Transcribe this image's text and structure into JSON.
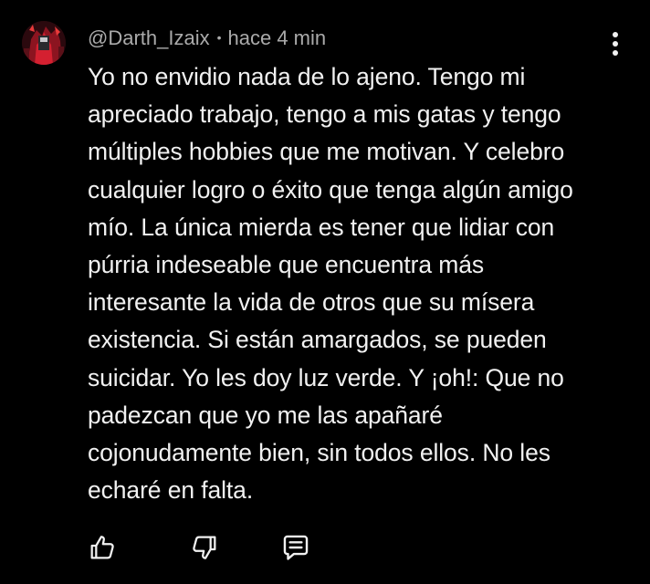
{
  "comment": {
    "author": "@Darth_Izaix",
    "separator": "•",
    "timestamp": "hace 4 min",
    "text": "Yo no envidio nada de lo ajeno. Tengo mi\napreciado trabajo, tengo a mis gatas y tengo\nmúltiples hobbies que me motivan. Y celebro\ncualquier logro o éxito que tenga algún amigo\nmío. La única mierda es tener que lidiar con\npúrria indeseable que encuentra más\ninteresante la vida de otros que su mísera\nexistencia. Si están amargados, se pueden\nsuicidar. Yo les doy luz verde. Y ¡oh!: Que no\npadezcan que yo me las apañaré\ncojonudamente bien, sin todos ellos. No les\necharé en falta."
  },
  "icons": {
    "avatar": "user-avatar",
    "menu": "more-vert-icon",
    "like": "thumb-up-icon",
    "dislike": "thumb-down-icon",
    "reply": "comment-reply-icon"
  },
  "colors": {
    "background": "#000000",
    "text": "#f1f1f1",
    "meta": "#aaaaaa"
  }
}
